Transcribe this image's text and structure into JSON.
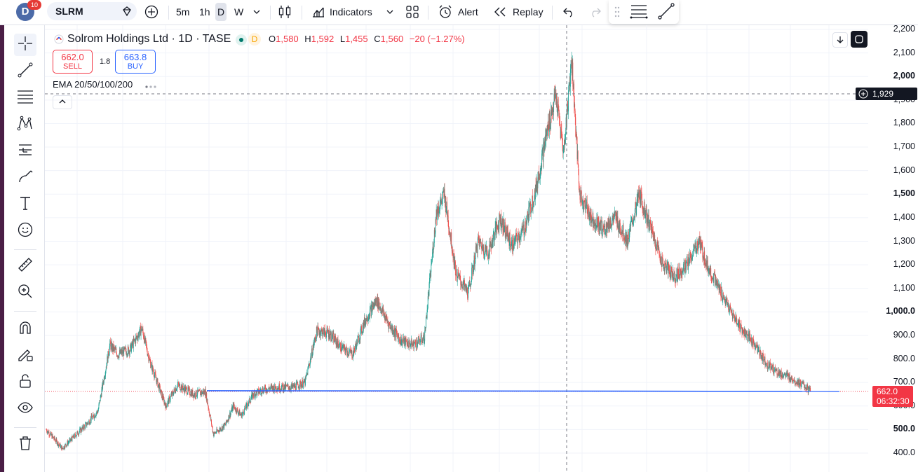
{
  "topbar": {
    "logo_letter": "D",
    "badge_count": "10",
    "symbol": "SLRM",
    "intervals": [
      "5m",
      "1h",
      "D",
      "W"
    ],
    "indicators_label": "Indicators",
    "alert_label": "Alert",
    "replay_label": "Replay"
  },
  "legend": {
    "title": "Solrom Holdings Ltd · 1D · TASE",
    "status_letter": "D",
    "open_key": "O",
    "open": "1,580",
    "high_key": "H",
    "high": "1,592",
    "low_key": "L",
    "low": "1,455",
    "close_key": "C",
    "close": "1,560",
    "change": "−20 (−1.27%)",
    "sell_price": "662.0",
    "sell_label": "SELL",
    "spread": "1.8",
    "buy_price": "663.8",
    "buy_label": "BUY",
    "indicator": "EMA 20/50/100/200"
  },
  "price_scale": {
    "labels": [
      "2,200",
      "2,100",
      "2,000",
      "1,900",
      "1,800",
      "1,700",
      "1,600",
      "1,500",
      "1,400",
      "1,300",
      "1,200",
      "1,100",
      "1,000.0",
      "900.0",
      "800.0",
      "700.0",
      "600.0",
      "500.0",
      "400.0"
    ],
    "bold_labels": [
      "2,000",
      "1,500",
      "1,000.0",
      "500.0"
    ],
    "crosshair_price": "1,929",
    "last_price": "662.0",
    "countdown": "06:32:30",
    "horizontal_line_price": 662
  },
  "colors": {
    "up": "#26a69a",
    "down": "#ef5350",
    "line": "#2962ff",
    "accent": "#2962ff",
    "sell": "#f23645"
  },
  "chart_data": {
    "type": "candlestick",
    "series": "daily",
    "y_range": [
      370,
      2220
    ],
    "close_path": [
      [
        0,
        500
      ],
      [
        40,
        420
      ],
      [
        70,
        470
      ],
      [
        100,
        520
      ],
      [
        130,
        580
      ],
      [
        160,
        860
      ],
      [
        180,
        820
      ],
      [
        210,
        840
      ],
      [
        240,
        930
      ],
      [
        260,
        790
      ],
      [
        300,
        600
      ],
      [
        330,
        690
      ],
      [
        370,
        650
      ],
      [
        400,
        660
      ],
      [
        420,
        480
      ],
      [
        450,
        520
      ],
      [
        470,
        600
      ],
      [
        490,
        560
      ],
      [
        520,
        650
      ],
      [
        545,
        670
      ],
      [
        580,
        680
      ],
      [
        620,
        680
      ],
      [
        650,
        700
      ],
      [
        680,
        920
      ],
      [
        710,
        910
      ],
      [
        740,
        850
      ],
      [
        770,
        820
      ],
      [
        800,
        960
      ],
      [
        830,
        1050
      ],
      [
        860,
        950
      ],
      [
        890,
        880
      ],
      [
        920,
        860
      ],
      [
        950,
        890
      ],
      [
        980,
        1420
      ],
      [
        1000,
        1500
      ],
      [
        1030,
        1160
      ],
      [
        1060,
        1080
      ],
      [
        1085,
        1300
      ],
      [
        1110,
        1250
      ],
      [
        1140,
        1400
      ],
      [
        1170,
        1280
      ],
      [
        1200,
        1350
      ],
      [
        1230,
        1520
      ],
      [
        1260,
        1780
      ],
      [
        1280,
        1920
      ],
      [
        1300,
        1680
      ],
      [
        1320,
        2080
      ],
      [
        1340,
        1500
      ],
      [
        1370,
        1400
      ],
      [
        1400,
        1350
      ],
      [
        1430,
        1400
      ],
      [
        1460,
        1300
      ],
      [
        1490,
        1500
      ],
      [
        1520,
        1350
      ],
      [
        1550,
        1200
      ],
      [
        1580,
        1150
      ],
      [
        1610,
        1200
      ],
      [
        1640,
        1300
      ],
      [
        1660,
        1200
      ],
      [
        1690,
        1100
      ],
      [
        1720,
        1000
      ],
      [
        1750,
        920
      ],
      [
        1780,
        860
      ],
      [
        1810,
        780
      ],
      [
        1840,
        740
      ],
      [
        1870,
        720
      ],
      [
        1900,
        690
      ],
      [
        1920,
        662
      ]
    ]
  }
}
